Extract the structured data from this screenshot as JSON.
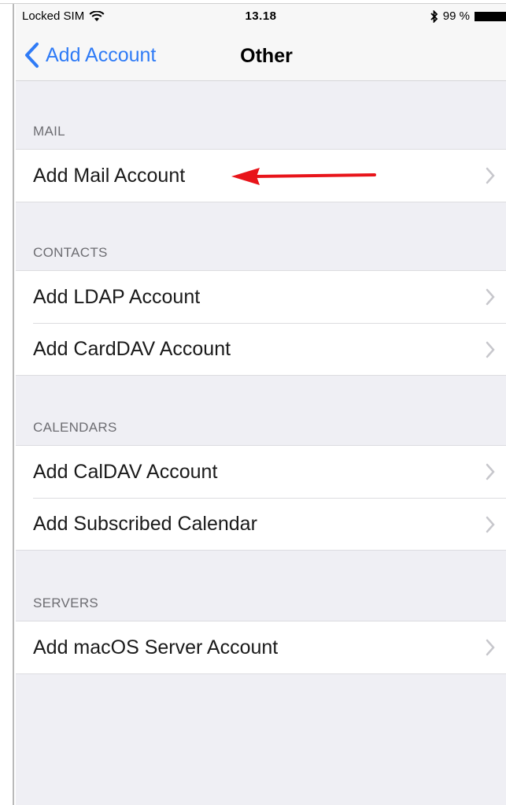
{
  "status_bar": {
    "carrier": "Locked SIM",
    "wifi_icon": "wifi-icon",
    "time": "13.18",
    "bluetooth_icon": "bluetooth-icon",
    "battery_percent": "99 %"
  },
  "nav": {
    "back_label": "Add Account",
    "title": "Other"
  },
  "sections": [
    {
      "header": "MAIL",
      "rows": [
        "Add Mail Account"
      ]
    },
    {
      "header": "CONTACTS",
      "rows": [
        "Add LDAP Account",
        "Add CardDAV Account"
      ]
    },
    {
      "header": "CALENDARS",
      "rows": [
        "Add CalDAV Account",
        "Add Subscribed Calendar"
      ]
    },
    {
      "header": "SERVERS",
      "rows": [
        "Add macOS Server Account"
      ]
    }
  ],
  "colors": {
    "accent": "#2f7bf6",
    "annotation_arrow": "#e8141a",
    "background": "#efeff4"
  }
}
